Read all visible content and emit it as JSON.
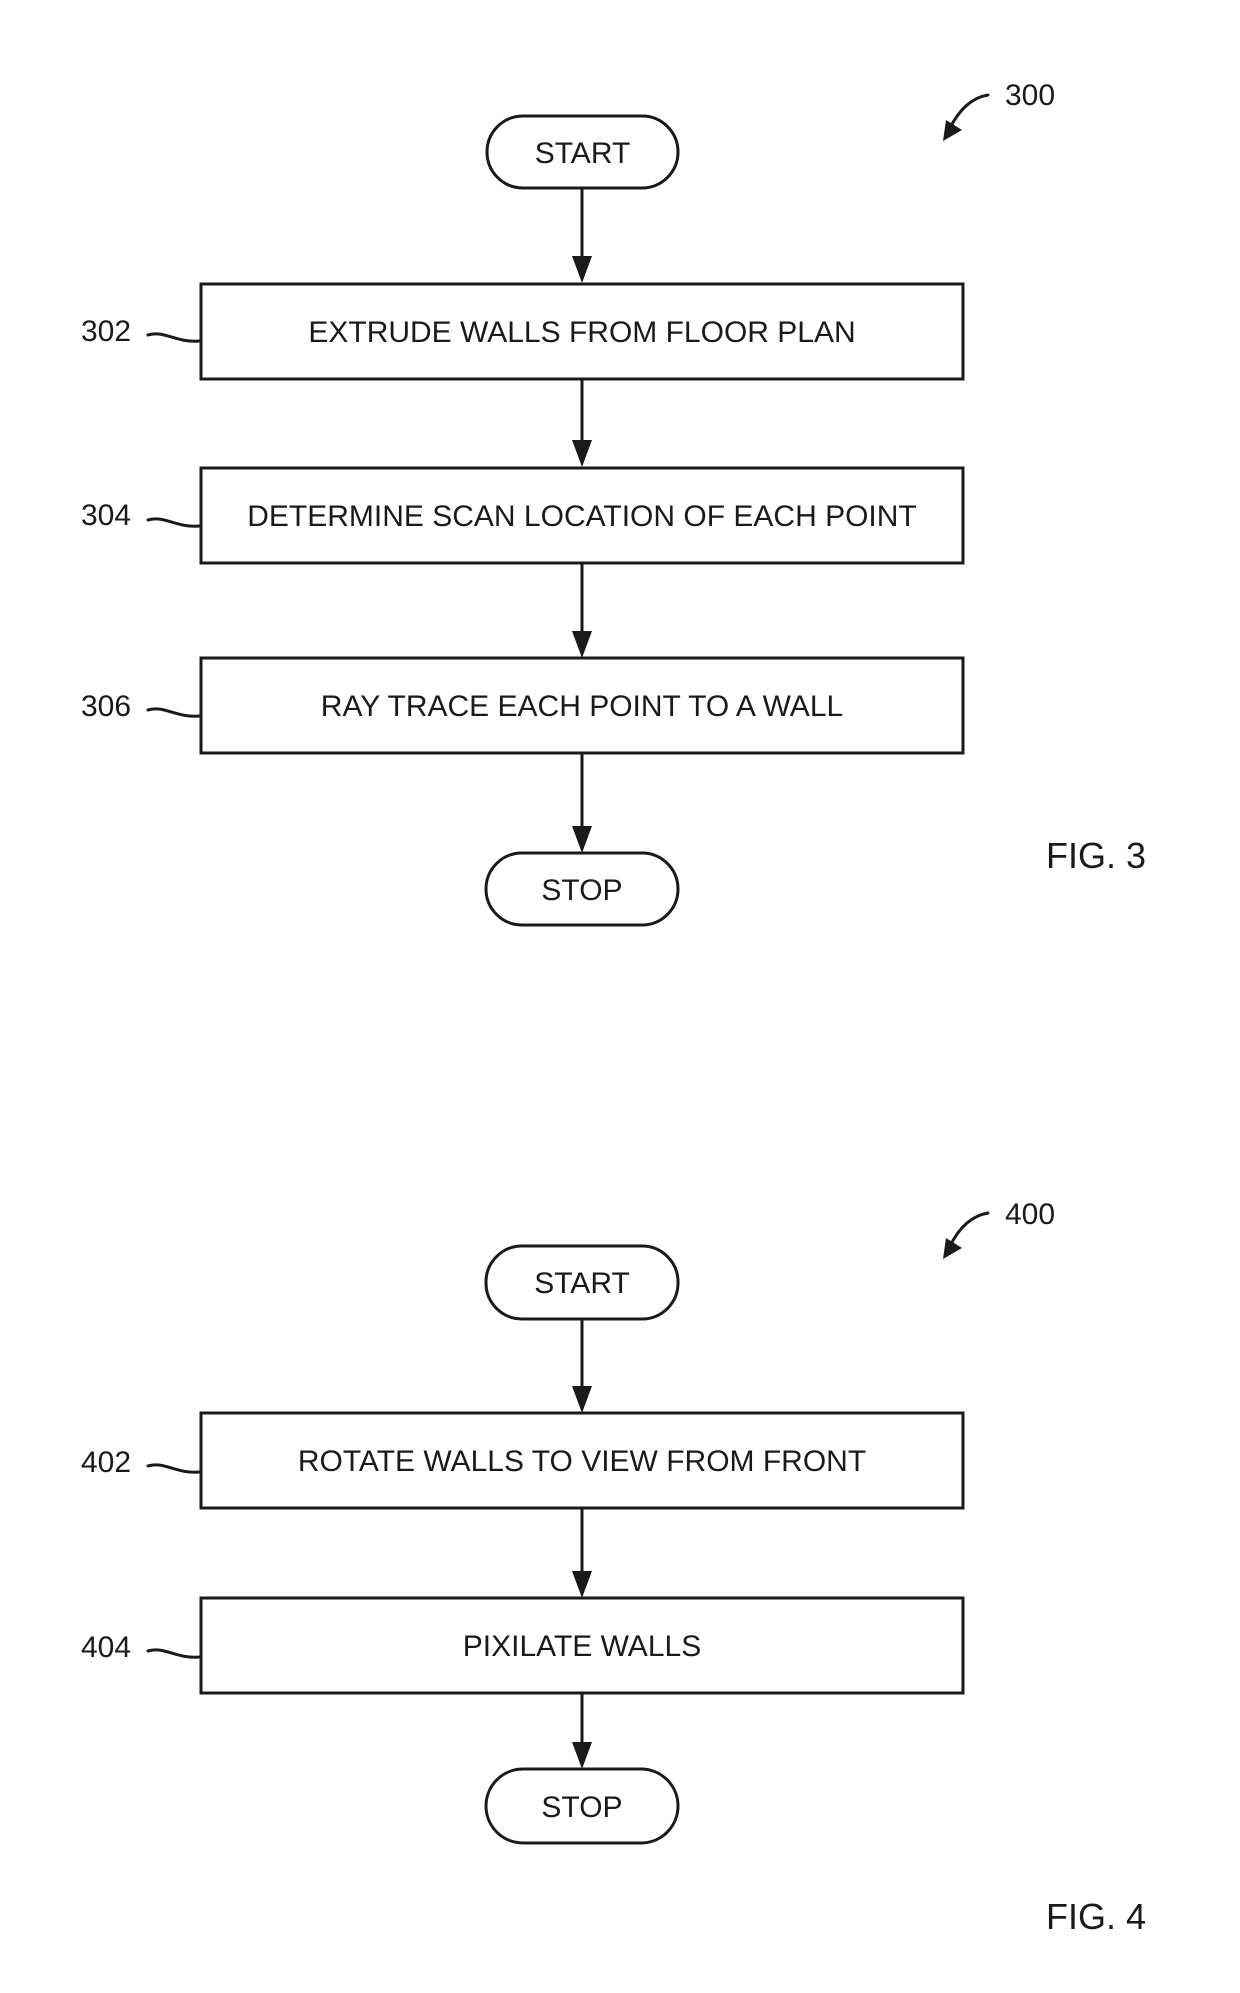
{
  "figures": [
    {
      "id": "fig3",
      "figure_label": "FIG. 3",
      "reference_number": "300",
      "start_label": "START",
      "stop_label": "STOP",
      "steps": [
        {
          "ref": "302",
          "label": "EXTRUDE WALLS FROM FLOOR PLAN"
        },
        {
          "ref": "304",
          "label": "DETERMINE SCAN LOCATION OF EACH POINT"
        },
        {
          "ref": "306",
          "label": "RAY TRACE EACH POINT TO A WALL"
        }
      ]
    },
    {
      "id": "fig4",
      "figure_label": "FIG. 4",
      "reference_number": "400",
      "start_label": "START",
      "stop_label": "STOP",
      "steps": [
        {
          "ref": "402",
          "label": "ROTATE WALLS TO VIEW FROM FRONT"
        },
        {
          "ref": "404",
          "label": "PIXILATE WALLS"
        }
      ]
    }
  ]
}
